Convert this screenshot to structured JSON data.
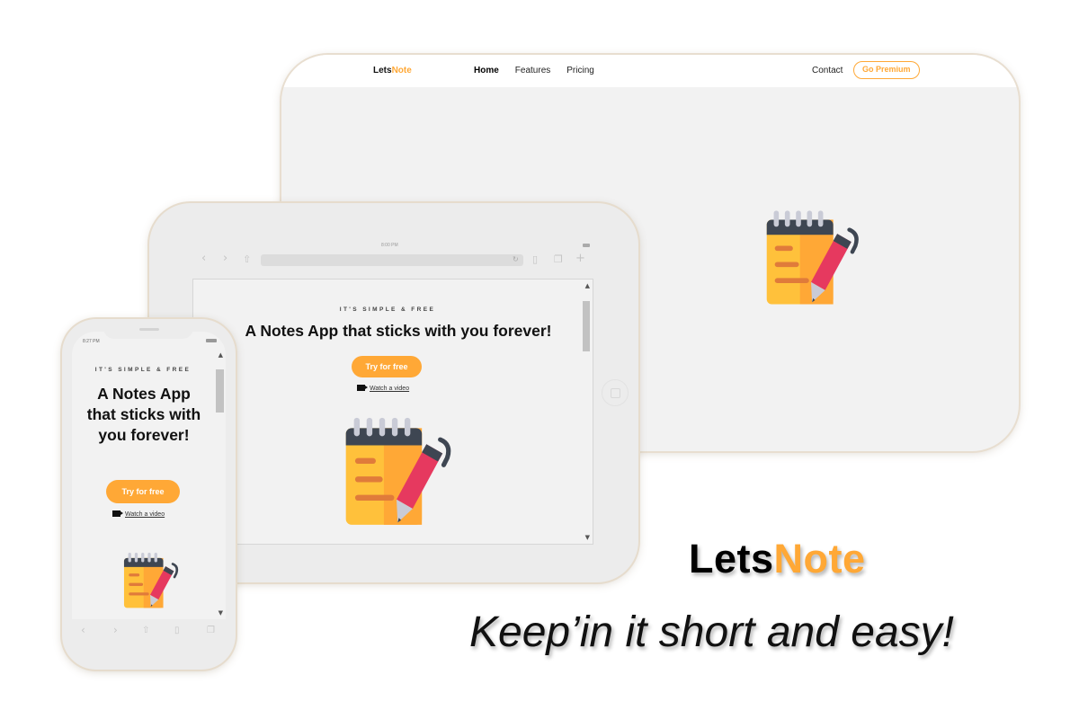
{
  "colors": {
    "accent": "#ffa836",
    "background": "#ffffff",
    "screen_bg": "#f2f2f2",
    "icon_yellow": "#ffc13b",
    "icon_orange": "#ffa836",
    "icon_pink": "#e6395f",
    "icon_dark": "#3e4652"
  },
  "desktop": {
    "logo_part1": "Lets",
    "logo_part2": "Note",
    "nav": {
      "home": "Home",
      "features": "Features",
      "pricing": "Pricing",
      "contact": "Contact",
      "premium": "Go Premium"
    },
    "hero_icon": "notepad-pen-icon"
  },
  "tablet": {
    "status_time": "8:00 PM",
    "kicker": "IT'S SIMPLE & FREE",
    "title": "A Notes App that sticks with you forever!",
    "cta": "Try for free",
    "video_link": "Watch a video",
    "toolbar_icons": [
      "chevron-left-icon",
      "chevron-right-icon",
      "share-icon",
      "reload-icon",
      "book-icon",
      "tabs-icon",
      "plus-icon"
    ]
  },
  "phone": {
    "status_time": "8:27 PM",
    "kicker": "IT'S SIMPLE & FREE",
    "title": "A Notes App that sticks with you forever!",
    "cta": "Try for free",
    "video_link": "Watch a video",
    "toolbar_icons": [
      "chevron-left-icon",
      "chevron-right-icon",
      "share-icon",
      "book-icon",
      "tabs-icon"
    ]
  },
  "brand": {
    "part1": "Lets",
    "part2": "Note"
  },
  "tagline": "Keep’in it short and easy!"
}
